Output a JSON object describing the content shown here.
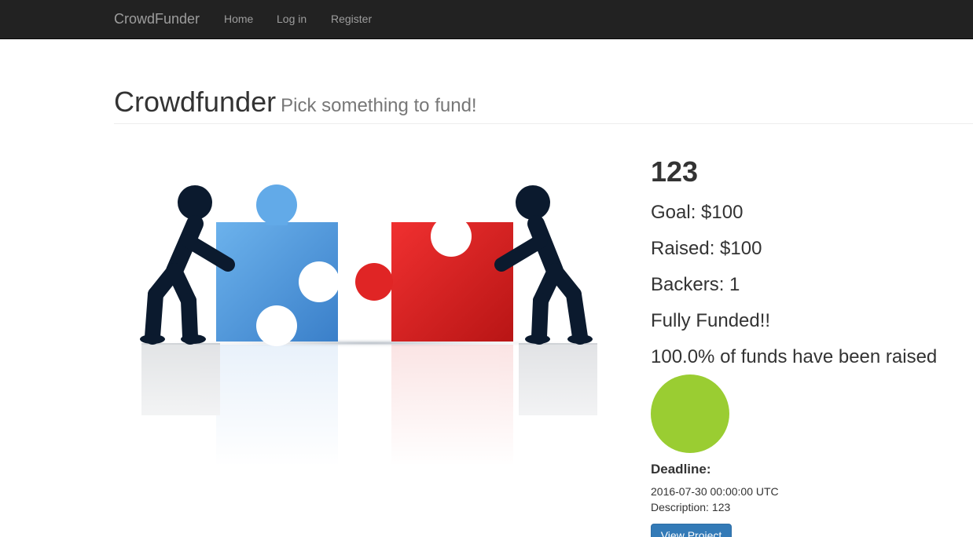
{
  "navbar": {
    "brand": "CrowdFunder",
    "links": [
      {
        "label": "Home"
      },
      {
        "label": "Log in"
      },
      {
        "label": "Register"
      }
    ]
  },
  "header": {
    "title": "Crowdfunder",
    "subtitle": "Pick something to fund!"
  },
  "project": {
    "name": "123",
    "goal": "Goal: $100",
    "raised": "Raised: $100",
    "backers": "Backers: 1",
    "status": "Fully Funded!!",
    "percent": "100.0% of funds have been raised",
    "funded_fraction": 1.0,
    "status_color": "#9acd32",
    "deadline_label": "Deadline:",
    "deadline_value": "2016-07-30 00:00:00 UTC",
    "description_label": "Description:",
    "description_value": "123",
    "view_button": "View Project"
  },
  "colors": {
    "navbar_bg": "#222222",
    "nav_text": "#9d9d9d",
    "button_primary": "#337ab7",
    "puzzle_blue": "#4a90d9",
    "puzzle_red": "#d91c1c",
    "figure": "#0b1a2e"
  },
  "image": {
    "icon": "teamwork-puzzle-illustration"
  }
}
